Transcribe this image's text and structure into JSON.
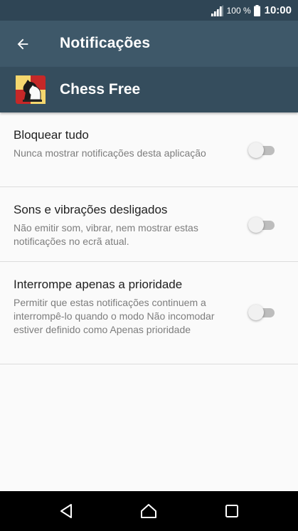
{
  "status_bar": {
    "battery_percent": "100 %",
    "time": "10:00",
    "icons": [
      "signal-icon",
      "battery-icon"
    ]
  },
  "app_bar": {
    "title": "Notificações",
    "back_icon": "arrow-back-icon"
  },
  "app_header": {
    "app_name": "Chess Free",
    "app_icon": "chess-knight-icon"
  },
  "settings": [
    {
      "title": "Bloquear tudo",
      "summary": "Nunca mostrar notificações desta aplicação",
      "enabled": false
    },
    {
      "title": "Sons e vibrações desligados",
      "summary": "Não emitir som, vibrar, nem mostrar estas notificações no ecrã atual.",
      "enabled": false
    },
    {
      "title": "Interrompe apenas a prioridade",
      "summary": "Permitir que estas notificações continuem a interrompê-lo quando o modo Não incomodar estiver definido como Apenas prioridade",
      "enabled": false
    }
  ],
  "nav_bar": {
    "buttons": [
      "back-triangle-icon",
      "home-icon",
      "recents-icon"
    ]
  },
  "colors": {
    "status_bar": "#2f4555",
    "app_bar": "#3e5869",
    "app_header": "#354d5d",
    "background": "#fafafa",
    "toggle_off_track": "#bdbdbd"
  }
}
